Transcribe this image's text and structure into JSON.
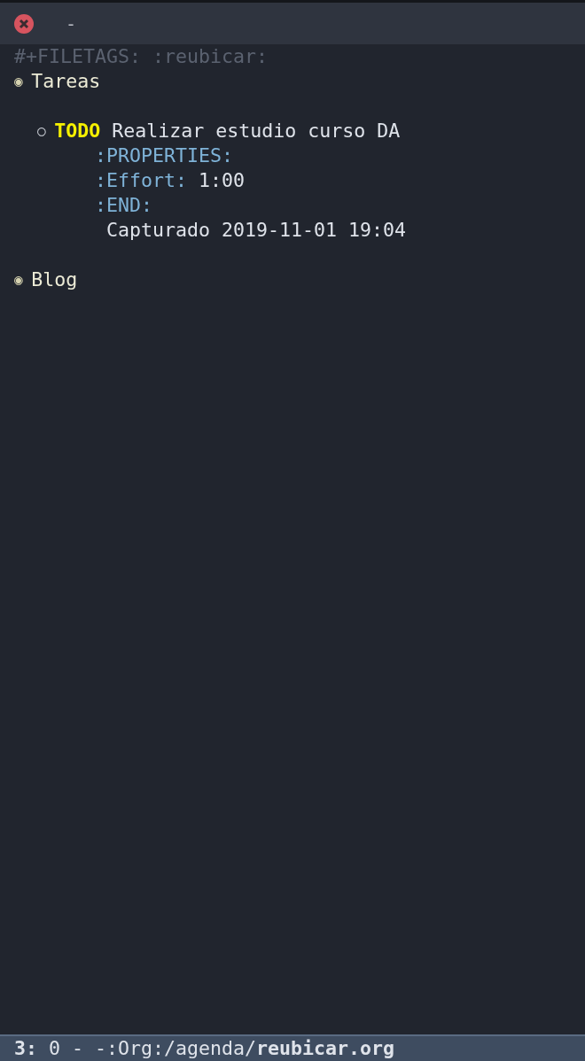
{
  "title_bar": {
    "title": "-"
  },
  "buffer": {
    "filetags": "#+FILETAGS: :reubicar:",
    "headings": [
      {
        "bullet": "◉",
        "title": "Tareas",
        "children": [
          {
            "bullet": "○",
            "keyword": "TODO",
            "title": "Realizar estudio curso DA",
            "drawer": {
              "open": ":PROPERTIES:",
              "properties": [
                {
                  "key": ":Effort:",
                  "value": "1:00"
                }
              ],
              "close": ":END:"
            },
            "body": "Capturado 2019-11-01 19:04"
          }
        ]
      },
      {
        "bullet": "◉",
        "title": "Blog"
      }
    ]
  },
  "mode_line": {
    "text": "**3:** 0 - -:Org:/agenda/**reubicar.org**"
  }
}
